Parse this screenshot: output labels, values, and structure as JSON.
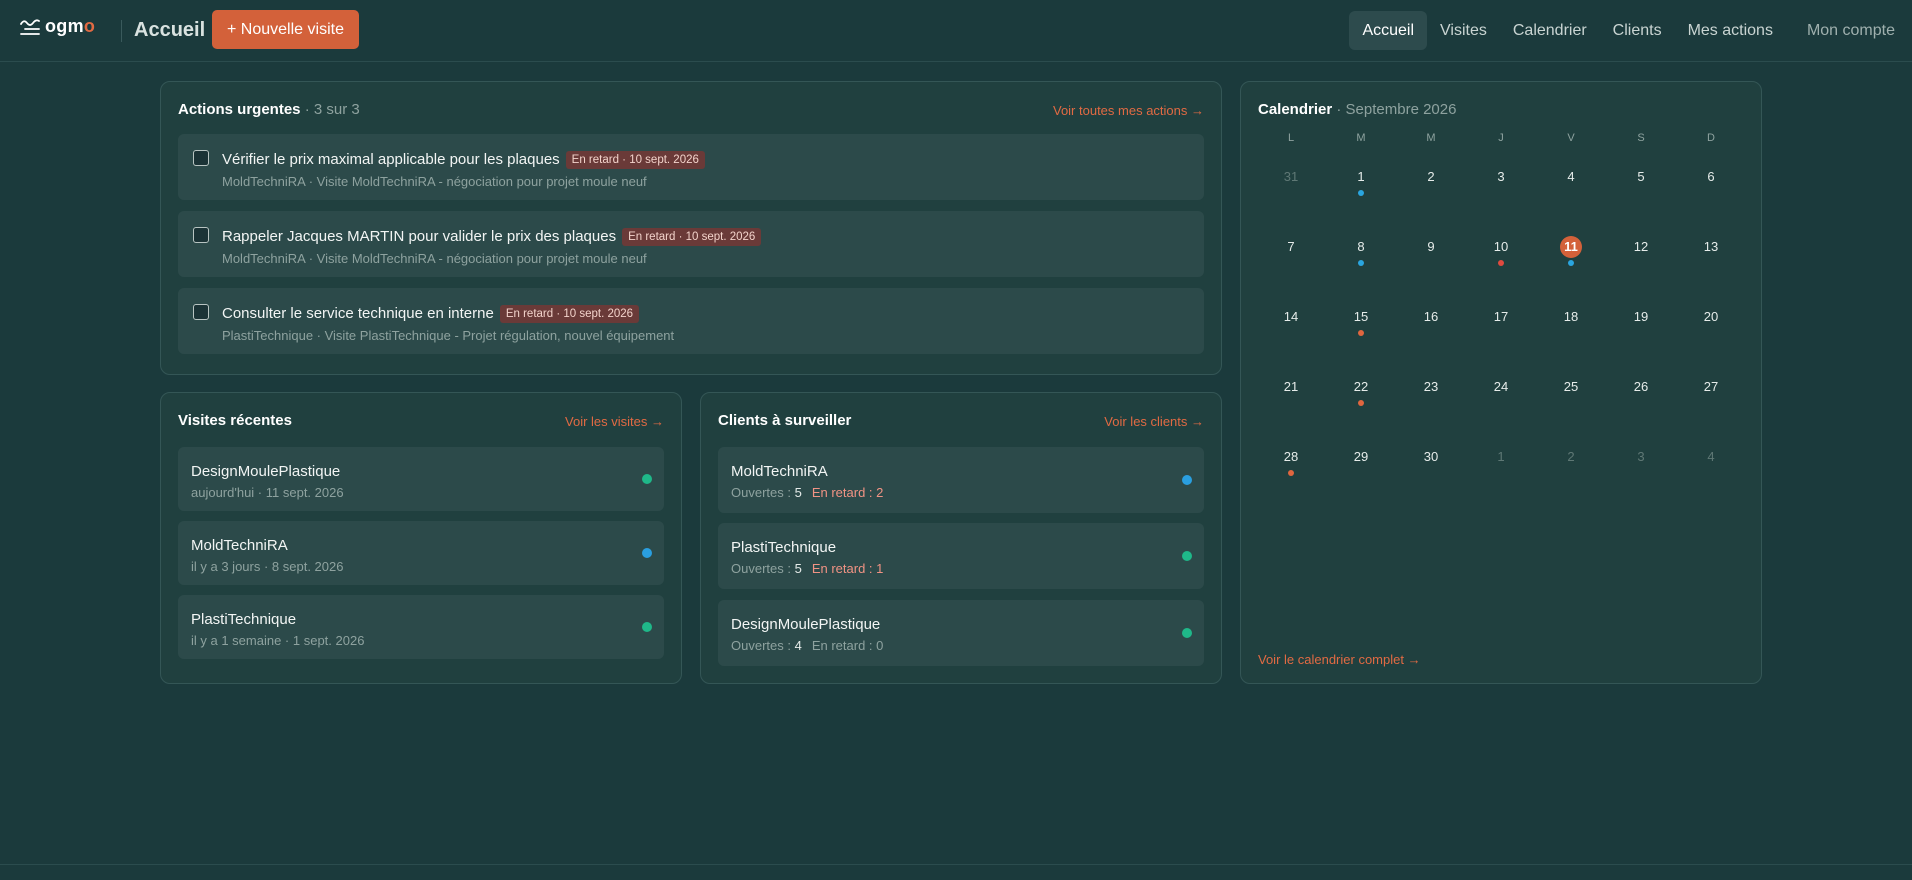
{
  "app": {
    "logo_text": "ogm",
    "logo_accent": "o",
    "page_title": "Accueil"
  },
  "header": {
    "new_visit_label": "+ Nouvelle visite",
    "nav": [
      "Accueil",
      "Visites",
      "Calendrier",
      "Clients",
      "Mes actions"
    ],
    "account_label": "Mon compte"
  },
  "urgent": {
    "title": "Actions urgentes",
    "count": "· 3 sur 3",
    "link": "Voir toutes mes actions →",
    "items": [
      {
        "title": "Vérifier le prix maximal applicable pour les plaques",
        "badge": "En retard · 10 sept. 2026",
        "meta": "MoldTechniRA · Visite MoldTechniRA - négociation pour projet moule neuf"
      },
      {
        "title": "Rappeler Jacques MARTIN pour valider le prix des plaques",
        "badge": "En retard · 10 sept. 2026",
        "meta": "MoldTechniRA · Visite MoldTechniRA - négociation pour projet moule neuf"
      },
      {
        "title": "Consulter le service technique en interne",
        "badge": "En retard · 10 sept. 2026",
        "meta": "PlastiTechnique · Visite PlastiTechnique - Projet régulation, nouvel équipement"
      }
    ]
  },
  "visits": {
    "title": "Visites récentes",
    "link": "Voir les visites →",
    "items": [
      {
        "name": "DesignMoulePlastique",
        "sub": "aujourd'hui · 11 sept. 2026",
        "color": "#1fb889"
      },
      {
        "name": "MoldTechniRA",
        "sub": "il y a 3 jours · 8 sept. 2026",
        "color": "#2a9fe0"
      },
      {
        "name": "PlastiTechnique",
        "sub": "il y a 1 semaine · 1 sept. 2026",
        "color": "#1fb889"
      }
    ]
  },
  "clients": {
    "title": "Clients à surveiller",
    "link": "Voir les clients →",
    "open_label": "Ouvertes :",
    "late_label": "En retard :",
    "items": [
      {
        "name": "MoldTechniRA",
        "open": "5",
        "late": "2",
        "color": "#2a9fe0"
      },
      {
        "name": "PlastiTechnique",
        "open": "5",
        "late": "1",
        "color": "#1fb889"
      },
      {
        "name": "DesignMoulePlastique",
        "open": "4",
        "late": "0",
        "color": "#1fb889"
      }
    ]
  },
  "calendar": {
    "title": "Calendrier",
    "month": "· Septembre 2026",
    "weekdays": [
      "L",
      "M",
      "M",
      "J",
      "V",
      "S",
      "D"
    ],
    "footer_link": "Voir le calendrier complet →",
    "today": "11",
    "colors": {
      "blue": "#2aa6e0",
      "orange": "#e0663f",
      "red": "#e04a3f"
    },
    "weeks": [
      [
        {
          "d": "31",
          "m": true
        },
        {
          "d": "1",
          "dot": "blue"
        },
        {
          "d": "2"
        },
        {
          "d": "3"
        },
        {
          "d": "4"
        },
        {
          "d": "5"
        },
        {
          "d": "6"
        }
      ],
      [
        {
          "d": "7"
        },
        {
          "d": "8",
          "dot": "blue"
        },
        {
          "d": "9"
        },
        {
          "d": "10",
          "dot": "red"
        },
        {
          "d": "11",
          "dot": "blue"
        },
        {
          "d": "12"
        },
        {
          "d": "13"
        }
      ],
      [
        {
          "d": "14"
        },
        {
          "d": "15",
          "dot": "orange"
        },
        {
          "d": "16"
        },
        {
          "d": "17"
        },
        {
          "d": "18"
        },
        {
          "d": "19"
        },
        {
          "d": "20"
        }
      ],
      [
        {
          "d": "21"
        },
        {
          "d": "22",
          "dot": "orange"
        },
        {
          "d": "23"
        },
        {
          "d": "24"
        },
        {
          "d": "25"
        },
        {
          "d": "26"
        },
        {
          "d": "27"
        }
      ],
      [
        {
          "d": "28",
          "dot": "orange"
        },
        {
          "d": "29"
        },
        {
          "d": "30"
        },
        {
          "d": "1",
          "m": true
        },
        {
          "d": "2",
          "m": true
        },
        {
          "d": "3",
          "m": true
        },
        {
          "d": "4",
          "m": true
        }
      ]
    ]
  }
}
